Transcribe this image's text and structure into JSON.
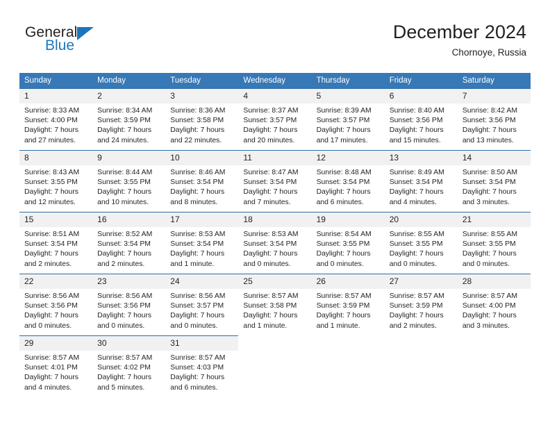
{
  "brand": {
    "name_top": "General",
    "name_bottom": "Blue",
    "triangle_color": "#1a76bc"
  },
  "header": {
    "title": "December 2024",
    "subtitle": "Chornoye, Russia"
  },
  "theme": {
    "header_blue": "#3778b6",
    "row_border_blue": "#2e6da4",
    "daynum_band": "#f1f1f1",
    "text": "#231f20"
  },
  "weekday_headers": [
    "Sunday",
    "Monday",
    "Tuesday",
    "Wednesday",
    "Thursday",
    "Friday",
    "Saturday"
  ],
  "weeks": [
    [
      {
        "day": "1",
        "sunrise": "Sunrise: 8:33 AM",
        "sunset": "Sunset: 4:00 PM",
        "daylight_1": "Daylight: 7 hours",
        "daylight_2": "and 27 minutes."
      },
      {
        "day": "2",
        "sunrise": "Sunrise: 8:34 AM",
        "sunset": "Sunset: 3:59 PM",
        "daylight_1": "Daylight: 7 hours",
        "daylight_2": "and 24 minutes."
      },
      {
        "day": "3",
        "sunrise": "Sunrise: 8:36 AM",
        "sunset": "Sunset: 3:58 PM",
        "daylight_1": "Daylight: 7 hours",
        "daylight_2": "and 22 minutes."
      },
      {
        "day": "4",
        "sunrise": "Sunrise: 8:37 AM",
        "sunset": "Sunset: 3:57 PM",
        "daylight_1": "Daylight: 7 hours",
        "daylight_2": "and 20 minutes."
      },
      {
        "day": "5",
        "sunrise": "Sunrise: 8:39 AM",
        "sunset": "Sunset: 3:57 PM",
        "daylight_1": "Daylight: 7 hours",
        "daylight_2": "and 17 minutes."
      },
      {
        "day": "6",
        "sunrise": "Sunrise: 8:40 AM",
        "sunset": "Sunset: 3:56 PM",
        "daylight_1": "Daylight: 7 hours",
        "daylight_2": "and 15 minutes."
      },
      {
        "day": "7",
        "sunrise": "Sunrise: 8:42 AM",
        "sunset": "Sunset: 3:56 PM",
        "daylight_1": "Daylight: 7 hours",
        "daylight_2": "and 13 minutes."
      }
    ],
    [
      {
        "day": "8",
        "sunrise": "Sunrise: 8:43 AM",
        "sunset": "Sunset: 3:55 PM",
        "daylight_1": "Daylight: 7 hours",
        "daylight_2": "and 12 minutes."
      },
      {
        "day": "9",
        "sunrise": "Sunrise: 8:44 AM",
        "sunset": "Sunset: 3:55 PM",
        "daylight_1": "Daylight: 7 hours",
        "daylight_2": "and 10 minutes."
      },
      {
        "day": "10",
        "sunrise": "Sunrise: 8:46 AM",
        "sunset": "Sunset: 3:54 PM",
        "daylight_1": "Daylight: 7 hours",
        "daylight_2": "and 8 minutes."
      },
      {
        "day": "11",
        "sunrise": "Sunrise: 8:47 AM",
        "sunset": "Sunset: 3:54 PM",
        "daylight_1": "Daylight: 7 hours",
        "daylight_2": "and 7 minutes."
      },
      {
        "day": "12",
        "sunrise": "Sunrise: 8:48 AM",
        "sunset": "Sunset: 3:54 PM",
        "daylight_1": "Daylight: 7 hours",
        "daylight_2": "and 6 minutes."
      },
      {
        "day": "13",
        "sunrise": "Sunrise: 8:49 AM",
        "sunset": "Sunset: 3:54 PM",
        "daylight_1": "Daylight: 7 hours",
        "daylight_2": "and 4 minutes."
      },
      {
        "day": "14",
        "sunrise": "Sunrise: 8:50 AM",
        "sunset": "Sunset: 3:54 PM",
        "daylight_1": "Daylight: 7 hours",
        "daylight_2": "and 3 minutes."
      }
    ],
    [
      {
        "day": "15",
        "sunrise": "Sunrise: 8:51 AM",
        "sunset": "Sunset: 3:54 PM",
        "daylight_1": "Daylight: 7 hours",
        "daylight_2": "and 2 minutes."
      },
      {
        "day": "16",
        "sunrise": "Sunrise: 8:52 AM",
        "sunset": "Sunset: 3:54 PM",
        "daylight_1": "Daylight: 7 hours",
        "daylight_2": "and 2 minutes."
      },
      {
        "day": "17",
        "sunrise": "Sunrise: 8:53 AM",
        "sunset": "Sunset: 3:54 PM",
        "daylight_1": "Daylight: 7 hours",
        "daylight_2": "and 1 minute."
      },
      {
        "day": "18",
        "sunrise": "Sunrise: 8:53 AM",
        "sunset": "Sunset: 3:54 PM",
        "daylight_1": "Daylight: 7 hours",
        "daylight_2": "and 0 minutes."
      },
      {
        "day": "19",
        "sunrise": "Sunrise: 8:54 AM",
        "sunset": "Sunset: 3:55 PM",
        "daylight_1": "Daylight: 7 hours",
        "daylight_2": "and 0 minutes."
      },
      {
        "day": "20",
        "sunrise": "Sunrise: 8:55 AM",
        "sunset": "Sunset: 3:55 PM",
        "daylight_1": "Daylight: 7 hours",
        "daylight_2": "and 0 minutes."
      },
      {
        "day": "21",
        "sunrise": "Sunrise: 8:55 AM",
        "sunset": "Sunset: 3:55 PM",
        "daylight_1": "Daylight: 7 hours",
        "daylight_2": "and 0 minutes."
      }
    ],
    [
      {
        "day": "22",
        "sunrise": "Sunrise: 8:56 AM",
        "sunset": "Sunset: 3:56 PM",
        "daylight_1": "Daylight: 7 hours",
        "daylight_2": "and 0 minutes."
      },
      {
        "day": "23",
        "sunrise": "Sunrise: 8:56 AM",
        "sunset": "Sunset: 3:56 PM",
        "daylight_1": "Daylight: 7 hours",
        "daylight_2": "and 0 minutes."
      },
      {
        "day": "24",
        "sunrise": "Sunrise: 8:56 AM",
        "sunset": "Sunset: 3:57 PM",
        "daylight_1": "Daylight: 7 hours",
        "daylight_2": "and 0 minutes."
      },
      {
        "day": "25",
        "sunrise": "Sunrise: 8:57 AM",
        "sunset": "Sunset: 3:58 PM",
        "daylight_1": "Daylight: 7 hours",
        "daylight_2": "and 1 minute."
      },
      {
        "day": "26",
        "sunrise": "Sunrise: 8:57 AM",
        "sunset": "Sunset: 3:59 PM",
        "daylight_1": "Daylight: 7 hours",
        "daylight_2": "and 1 minute."
      },
      {
        "day": "27",
        "sunrise": "Sunrise: 8:57 AM",
        "sunset": "Sunset: 3:59 PM",
        "daylight_1": "Daylight: 7 hours",
        "daylight_2": "and 2 minutes."
      },
      {
        "day": "28",
        "sunrise": "Sunrise: 8:57 AM",
        "sunset": "Sunset: 4:00 PM",
        "daylight_1": "Daylight: 7 hours",
        "daylight_2": "and 3 minutes."
      }
    ],
    [
      {
        "day": "29",
        "sunrise": "Sunrise: 8:57 AM",
        "sunset": "Sunset: 4:01 PM",
        "daylight_1": "Daylight: 7 hours",
        "daylight_2": "and 4 minutes."
      },
      {
        "day": "30",
        "sunrise": "Sunrise: 8:57 AM",
        "sunset": "Sunset: 4:02 PM",
        "daylight_1": "Daylight: 7 hours",
        "daylight_2": "and 5 minutes."
      },
      {
        "day": "31",
        "sunrise": "Sunrise: 8:57 AM",
        "sunset": "Sunset: 4:03 PM",
        "daylight_1": "Daylight: 7 hours",
        "daylight_2": "and 6 minutes."
      },
      null,
      null,
      null,
      null
    ]
  ]
}
